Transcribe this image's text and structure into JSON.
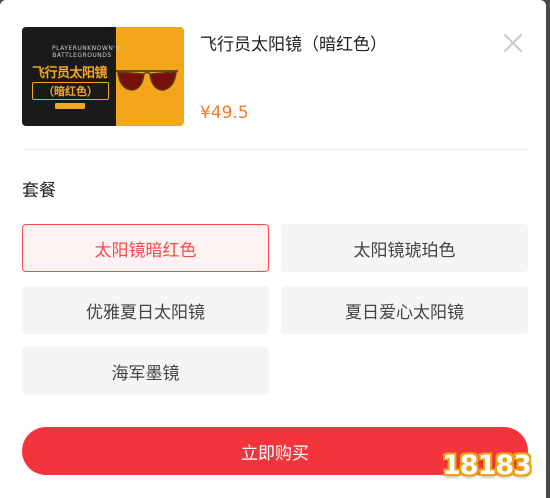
{
  "product": {
    "title": "飞行员太阳镜（暗红色）",
    "price": "¥49.5",
    "thumbnail": {
      "tagline": "PLAYERUNKNOWN'S BATTLEGROUNDS",
      "line1": "飞行员太阳镜",
      "line2": "（暗红色）"
    }
  },
  "options": {
    "label": "套餐",
    "items": [
      {
        "label": "太阳镜暗红色",
        "selected": true
      },
      {
        "label": "太阳镜琥珀色",
        "selected": false
      },
      {
        "label": "优雅夏日太阳镜",
        "selected": false
      },
      {
        "label": "夏日爱心太阳镜",
        "selected": false
      },
      {
        "label": "海军墨镜",
        "selected": false
      }
    ]
  },
  "actions": {
    "buy_label": "立即购买"
  },
  "watermark": "18183",
  "colors": {
    "accent": "#f2353d",
    "price": "#f5792a",
    "selected_border": "#f24c4c"
  }
}
